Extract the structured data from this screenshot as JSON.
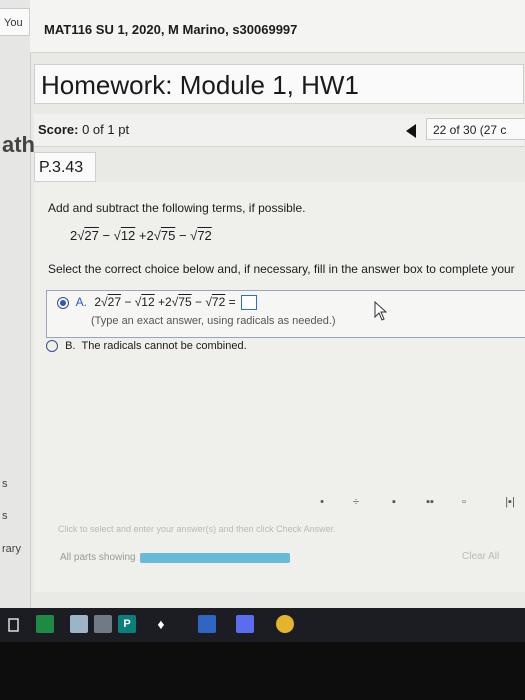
{
  "sidebar": {
    "you_tab": "You",
    "fragments": [
      "ath",
      "s",
      "s",
      "rary"
    ]
  },
  "header": {
    "course": "MAT116 SU 1, 2020, M Marino, s30069997"
  },
  "homework": {
    "title": "Homework: Module 1, HW1"
  },
  "score": {
    "label": "Score:",
    "value": "0 of 1 pt"
  },
  "navigation": {
    "question_count": "22 of 30 (27 c"
  },
  "question": {
    "id": "P.3.43",
    "instruction": "Add and subtract the following terms, if possible.",
    "expression": {
      "c1": "2",
      "r1": "27",
      "op1": "−",
      "r2": "12",
      "op2": "+2",
      "r3": "75",
      "op3": "−",
      "r4": "72"
    },
    "select_instruction": "Select the correct choice below and, if necessary, fill in the answer box to complete your",
    "choice_a": {
      "letter": "A.",
      "equals": "="
    },
    "choice_a_hint": "(Type an exact answer, using radicals as needed.)",
    "choice_b": {
      "letter": "B.",
      "text": "The radicals cannot be combined."
    }
  },
  "footer": {
    "instruction": "Click to select and enter your answer(s) and then click Check Answer.",
    "parts_showing": "All parts showing",
    "clear_all": "Clear All"
  },
  "taskbar": {
    "publisher_label": "P"
  }
}
